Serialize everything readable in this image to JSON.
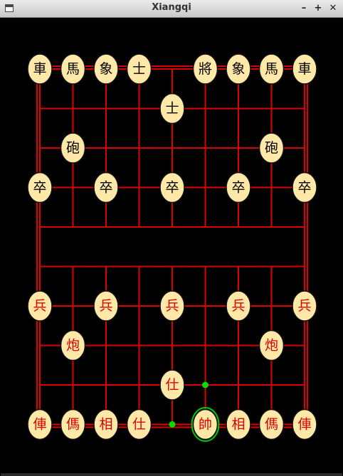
{
  "window": {
    "title": "Xiangqi",
    "controls": {
      "minimize": "–",
      "maximize": "+",
      "close": "✕"
    }
  },
  "colors": {
    "board_background": "#000000",
    "grid_line": "#dd0000",
    "piece_fill": "#ffe8a8",
    "piece_border": "#111111",
    "black_piece_text": "#000000",
    "red_piece_text": "#dd0000",
    "selection_ring": "#00c800",
    "move_hint": "#00dd00"
  },
  "board": {
    "files": 9,
    "ranks": 10
  },
  "pieces": [
    {
      "side": "black",
      "char": "車",
      "file": 0,
      "rank": 0,
      "icon": "black-chariot"
    },
    {
      "side": "black",
      "char": "馬",
      "file": 1,
      "rank": 0,
      "icon": "black-horse"
    },
    {
      "side": "black",
      "char": "象",
      "file": 2,
      "rank": 0,
      "icon": "black-elephant"
    },
    {
      "side": "black",
      "char": "士",
      "file": 3,
      "rank": 0,
      "icon": "black-advisor"
    },
    {
      "side": "black",
      "char": "將",
      "file": 5,
      "rank": 0,
      "icon": "black-general"
    },
    {
      "side": "black",
      "char": "象",
      "file": 6,
      "rank": 0,
      "icon": "black-elephant"
    },
    {
      "side": "black",
      "char": "馬",
      "file": 7,
      "rank": 0,
      "icon": "black-horse"
    },
    {
      "side": "black",
      "char": "車",
      "file": 8,
      "rank": 0,
      "icon": "black-chariot"
    },
    {
      "side": "black",
      "char": "士",
      "file": 4,
      "rank": 1,
      "icon": "black-advisor"
    },
    {
      "side": "black",
      "char": "砲",
      "file": 1,
      "rank": 2,
      "icon": "black-cannon"
    },
    {
      "side": "black",
      "char": "砲",
      "file": 7,
      "rank": 2,
      "icon": "black-cannon"
    },
    {
      "side": "black",
      "char": "卒",
      "file": 0,
      "rank": 3,
      "icon": "black-soldier"
    },
    {
      "side": "black",
      "char": "卒",
      "file": 2,
      "rank": 3,
      "icon": "black-soldier"
    },
    {
      "side": "black",
      "char": "卒",
      "file": 4,
      "rank": 3,
      "icon": "black-soldier"
    },
    {
      "side": "black",
      "char": "卒",
      "file": 6,
      "rank": 3,
      "icon": "black-soldier"
    },
    {
      "side": "black",
      "char": "卒",
      "file": 8,
      "rank": 3,
      "icon": "black-soldier"
    },
    {
      "side": "red",
      "char": "兵",
      "file": 0,
      "rank": 6,
      "icon": "red-soldier"
    },
    {
      "side": "red",
      "char": "兵",
      "file": 2,
      "rank": 6,
      "icon": "red-soldier"
    },
    {
      "side": "red",
      "char": "兵",
      "file": 4,
      "rank": 6,
      "icon": "red-soldier"
    },
    {
      "side": "red",
      "char": "兵",
      "file": 6,
      "rank": 6,
      "icon": "red-soldier"
    },
    {
      "side": "red",
      "char": "兵",
      "file": 8,
      "rank": 6,
      "icon": "red-soldier"
    },
    {
      "side": "red",
      "char": "炮",
      "file": 1,
      "rank": 7,
      "icon": "red-cannon"
    },
    {
      "side": "red",
      "char": "炮",
      "file": 7,
      "rank": 7,
      "icon": "red-cannon"
    },
    {
      "side": "red",
      "char": "仕",
      "file": 4,
      "rank": 8,
      "icon": "red-advisor"
    },
    {
      "side": "red",
      "char": "俥",
      "file": 0,
      "rank": 9,
      "icon": "red-chariot"
    },
    {
      "side": "red",
      "char": "傌",
      "file": 1,
      "rank": 9,
      "icon": "red-horse"
    },
    {
      "side": "red",
      "char": "相",
      "file": 2,
      "rank": 9,
      "icon": "red-elephant"
    },
    {
      "side": "red",
      "char": "仕",
      "file": 3,
      "rank": 9,
      "icon": "red-advisor"
    },
    {
      "side": "red",
      "char": "帥",
      "file": 5,
      "rank": 9,
      "icon": "red-general",
      "selected": true
    },
    {
      "side": "red",
      "char": "相",
      "file": 6,
      "rank": 9,
      "icon": "red-elephant"
    },
    {
      "side": "red",
      "char": "傌",
      "file": 7,
      "rank": 9,
      "icon": "red-horse"
    },
    {
      "side": "red",
      "char": "俥",
      "file": 8,
      "rank": 9,
      "icon": "red-chariot"
    }
  ],
  "move_hints": [
    {
      "file": 5,
      "rank": 0
    },
    {
      "file": 5,
      "rank": 8
    },
    {
      "file": 4,
      "rank": 9
    }
  ]
}
